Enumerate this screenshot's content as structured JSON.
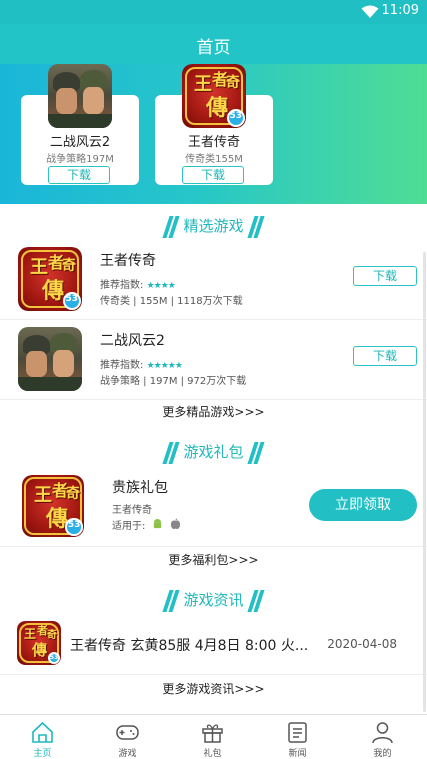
{
  "status": {
    "time": "11:09",
    "wifi_icon": "wifi-icon"
  },
  "header": {
    "title": "首页"
  },
  "banner": {
    "cards": [
      {
        "name": "二战风云2",
        "meta": "战争策略197M",
        "button": "下载",
        "icon": "war-game-icon"
      },
      {
        "name": "王者传奇",
        "meta": "传奇类155M",
        "button": "下载",
        "icon": "legend-game-icon"
      }
    ]
  },
  "featured": {
    "title": "精选游戏",
    "rating_label": "推荐指数:",
    "games": [
      {
        "name": "王者传奇",
        "rating": 4,
        "meta": "传奇类 | 155M | 1118万次下载",
        "button": "下载"
      },
      {
        "name": "二战风云2",
        "rating": 5,
        "meta": "战争策略 | 197M | 972万次下载",
        "button": "下载"
      }
    ],
    "more": "更多精品游戏>>>"
  },
  "gifts": {
    "title": "游戏礼包",
    "item": {
      "name": "贵族礼包",
      "game": "王者传奇",
      "platform_label": "适用于:",
      "platforms": [
        "android-icon",
        "apple-icon"
      ],
      "button": "立即领取"
    },
    "more": "更多福利包>>>"
  },
  "news": {
    "title": "游戏资讯",
    "item": {
      "title": "王者传奇 玄黄85服 4月8日 8:00 火...",
      "date": "2020-04-08"
    },
    "more": "更多游戏资讯>>>"
  },
  "tabs": [
    {
      "label": "主页",
      "icon": "home-icon",
      "active": true
    },
    {
      "label": "游戏",
      "icon": "gamepad-icon",
      "active": false
    },
    {
      "label": "礼包",
      "icon": "gift-icon",
      "active": false
    },
    {
      "label": "新闻",
      "icon": "news-icon",
      "active": false
    },
    {
      "label": "我的",
      "icon": "user-icon",
      "active": false
    }
  ],
  "colors": {
    "accent": "#22c0c4",
    "banner_start": "#1ab6d9",
    "banner_end": "#4fdd94"
  }
}
